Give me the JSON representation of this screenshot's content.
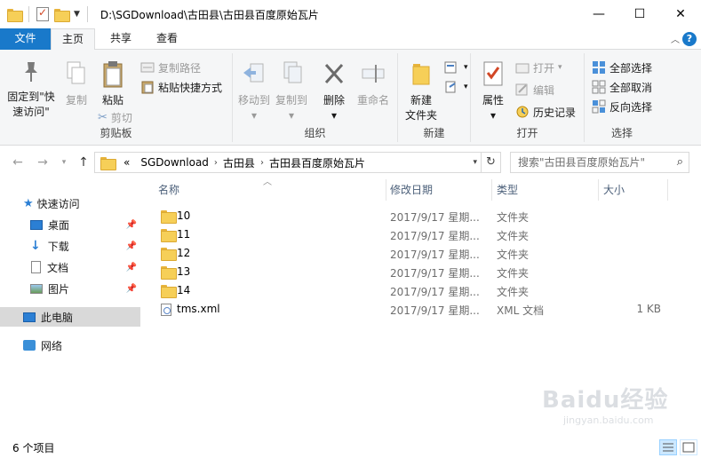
{
  "window": {
    "title_path": "D:\\SGDownload\\古田县\\古田县百度原始瓦片",
    "minimize": "—",
    "maximize": "☐",
    "close": "✕"
  },
  "tabs": {
    "file": "文件",
    "home": "主页",
    "share": "共享",
    "view": "查看"
  },
  "ribbon": {
    "clipboard": {
      "label": "剪贴板",
      "pin_quick_access": [
        "固定到\"快",
        "速访问\""
      ],
      "copy": "复制",
      "paste": "粘贴",
      "copy_path": "复制路径",
      "paste_shortcut": "粘贴快捷方式",
      "cut": "剪切"
    },
    "organize": {
      "label": "组织",
      "move_to": "移动到",
      "copy_to": "复制到",
      "delete": "删除",
      "rename": "重命名"
    },
    "new": {
      "label": "新建",
      "new_folder": [
        "新建",
        "文件夹"
      ]
    },
    "open": {
      "label": "打开",
      "properties": "属性",
      "open": "打开",
      "edit": "编辑",
      "history": "历史记录"
    },
    "select": {
      "label": "选择",
      "select_all": "全部选择",
      "select_none": "全部取消",
      "invert": "反向选择"
    }
  },
  "address": {
    "overflow": "«",
    "segments": [
      "SGDownload",
      "古田县",
      "古田县百度原始瓦片"
    ],
    "search_placeholder": "搜索\"古田县百度原始瓦片\""
  },
  "navpane": {
    "quick_access": "快速访问",
    "items": [
      "桌面",
      "下载",
      "文档",
      "图片"
    ],
    "this_pc": "此电脑",
    "network": "网络"
  },
  "columns": {
    "name": "名称",
    "date": "修改日期",
    "type": "类型",
    "size": "大小"
  },
  "files": [
    {
      "name": "10",
      "date": "2017/9/17 星期...",
      "type": "文件夹",
      "size": ""
    },
    {
      "name": "11",
      "date": "2017/9/17 星期...",
      "type": "文件夹",
      "size": ""
    },
    {
      "name": "12",
      "date": "2017/9/17 星期...",
      "type": "文件夹",
      "size": ""
    },
    {
      "name": "13",
      "date": "2017/9/17 星期...",
      "type": "文件夹",
      "size": ""
    },
    {
      "name": "14",
      "date": "2017/9/17 星期...",
      "type": "文件夹",
      "size": ""
    },
    {
      "name": "tms.xml",
      "date": "2017/9/17 星期...",
      "type": "XML 文档",
      "size": "1 KB"
    }
  ],
  "status": {
    "count": "6 个项目"
  },
  "watermark": {
    "brand": "Baidu经验",
    "url": "jingyan.baidu.com"
  },
  "colors": {
    "file_tab": "#1979ca",
    "folder": "#f6cf58",
    "ribbon_bg": "#f5f6f7",
    "selected_nav": "#d9d9d9"
  }
}
